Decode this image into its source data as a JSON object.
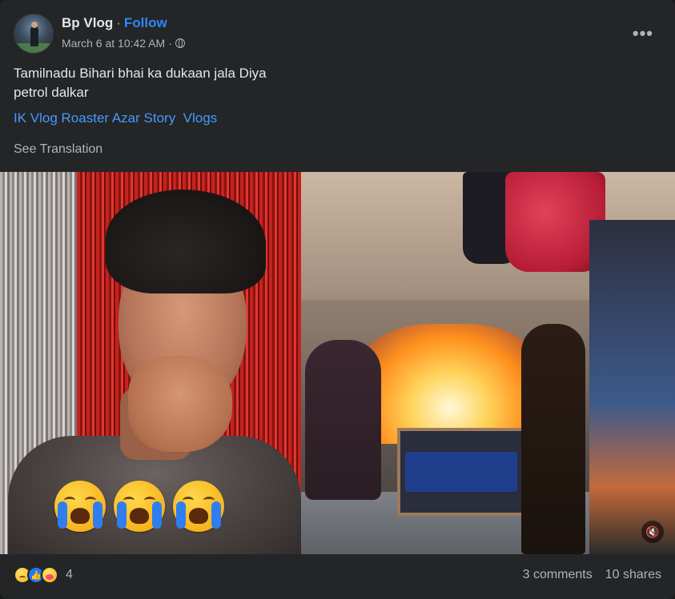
{
  "post": {
    "author": "Bp Vlog",
    "separator": "·",
    "follow_label": "Follow",
    "timestamp": "March 6 at 10:42 AM",
    "meta_separator": "·",
    "privacy_icon": "globe-icon",
    "more_icon": "•••",
    "text_line1": "Tamilnadu Bihari bhai ka dukaan jala Diya",
    "text_line2": "petrol dalkar",
    "tags": [
      "IK Vlog Roaster Azar Story",
      "Vlogs"
    ],
    "see_translation": "See Translation"
  },
  "media": {
    "left_panel_icons": [
      "loudly-crying-face-emoji",
      "loudly-crying-face-emoji",
      "loudly-crying-face-emoji"
    ],
    "mute_icon": "🔇"
  },
  "footer": {
    "reactions": [
      "sad-reaction",
      "like-reaction",
      "care-reaction"
    ],
    "reaction_count": "4",
    "comments": "3 comments",
    "shares": "10 shares"
  },
  "colors": {
    "background": "#242526",
    "link": "#2d88ff",
    "tag": "#4599ff",
    "text": "#e4e6eb",
    "muted": "#b0b3b8"
  }
}
